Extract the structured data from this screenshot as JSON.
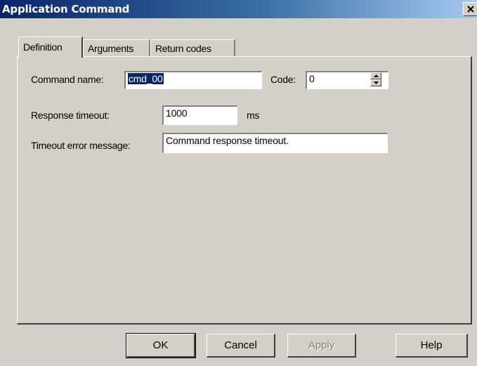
{
  "window": {
    "title": "Application Command",
    "close_glyph": "×"
  },
  "tabs": [
    {
      "label": "Definition",
      "active": true
    },
    {
      "label": "Arguments",
      "active": false
    },
    {
      "label": "Return codes",
      "active": false
    }
  ],
  "form": {
    "command_name": {
      "label": "Command name:",
      "value": "cmd_00"
    },
    "code": {
      "label": "Code:",
      "value": "0"
    },
    "response_timeout": {
      "label": "Response timeout:",
      "value": "1000",
      "unit": "ms"
    },
    "timeout_error_message": {
      "label": "Timeout error message:",
      "value": "Command response timeout."
    }
  },
  "buttons": {
    "ok": "OK",
    "cancel": "Cancel",
    "apply": "Apply",
    "help": "Help"
  },
  "colors": {
    "titlebar_start": "#0a246a",
    "titlebar_end": "#a6caf0",
    "dialog_face": "#d4d0c8",
    "selection": "#0a246a"
  },
  "icons": {
    "close": "close-icon",
    "spin_up": "arrow-up-icon",
    "spin_down": "arrow-down-icon"
  }
}
